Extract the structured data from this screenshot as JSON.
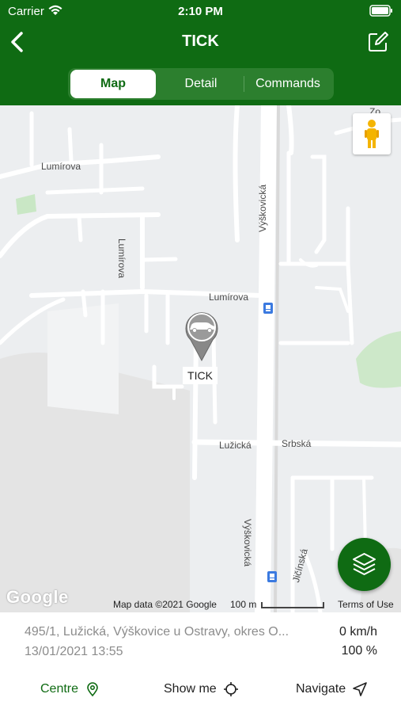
{
  "status_bar": {
    "carrier": "Carrier",
    "time": "2:10 PM"
  },
  "nav": {
    "title": "TICK",
    "back_icon": "chevron-left-icon",
    "edit_icon": "edit-icon"
  },
  "tabs": [
    {
      "label": "Map",
      "active": true
    },
    {
      "label": "Detail",
      "active": false
    },
    {
      "label": "Commands",
      "active": false
    }
  ],
  "map": {
    "street_labels": {
      "lumirova_top": "Lumírova",
      "lumirova_vertical": "Lumírova",
      "lumirova_mid": "Lumírova",
      "vyskovicka_top": "Výškovická",
      "vyskovicka_bottom": "Výškovická",
      "luzicka": "Lužická",
      "srbska": "Srbská",
      "jicinska": "Jičínská",
      "partial_top": "Zo"
    },
    "marker_label": "TICK",
    "google_logo": "Google",
    "map_data": "Map data ©2021 Google",
    "scale": "100 m",
    "terms": "Terms of Use"
  },
  "info": {
    "address": "495/1, Lužická, Výškovice u Ostravy, okres O...",
    "datetime": "13/01/2021 13:55",
    "speed": "0 km/h",
    "battery": "100 %"
  },
  "actions": {
    "centre": "Centre",
    "show_me": "Show me",
    "navigate": "Navigate"
  },
  "colors": {
    "brand_green": "#0f6b13",
    "map_background": "#eceef0",
    "road": "#ffffff"
  }
}
